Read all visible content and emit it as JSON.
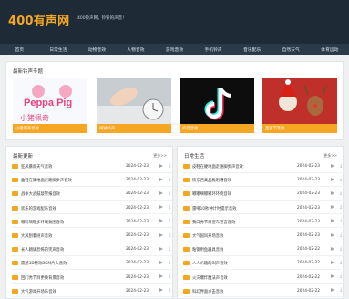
{
  "header": {
    "logo": "400有声网",
    "slogan": "400铃声网，铃铃的声音！"
  },
  "nav": [
    "首页",
    "日常生活",
    "动物音效",
    "人物音效",
    "游戏音效",
    "手机铃声",
    "音乐配乐",
    "自然天气",
    "体育运动"
  ],
  "featured": {
    "title": "最新铃声专题",
    "items": [
      {
        "caption": "小猪佩奇音效",
        "name": "peppa-pig"
      },
      {
        "caption": "闹钟铃声",
        "name": "alarm-clock"
      },
      {
        "caption": "抖音音效",
        "name": "tiktok"
      },
      {
        "caption": "圣诞节音效",
        "name": "christmas"
      }
    ]
  },
  "left": {
    "title": "最新更新",
    "more": "更多>>",
    "rows": [
      {
        "title": "狂风暴雨天气音效",
        "date": "2024-02-23"
      },
      {
        "title": "盒鞋在硬地面走路脚步声音效",
        "date": "2024-02-23"
      },
      {
        "title": "战争大战鼓敲警报音效",
        "date": "2024-02-23"
      },
      {
        "title": "欢乐的游戏配乐音效",
        "date": "2024-02-23"
      },
      {
        "title": "嘟吗嘀嘟多环境氛围音效",
        "date": "2024-02-23"
      },
      {
        "title": "大风刮着树声音效",
        "date": "2024-02-23"
      },
      {
        "title": "长人朗诵恐怖的笑声音效",
        "date": "2024-02-23"
      },
      {
        "title": "震撼3D特效BGM片头音效",
        "date": "2024-02-23"
      },
      {
        "title": "回门秀节目更换背景音效",
        "date": "2024-02-23"
      },
      {
        "title": "大气游戏开场乐音效",
        "date": "2024-02-23"
      }
    ]
  },
  "right": {
    "title": "日常生活",
    "more": "更多>>",
    "rows": [
      {
        "title": "皮鞋在硬地面走路脚步声音效",
        "date": "2024-02-23"
      },
      {
        "title": "饮东西高品脆咀嚼音效",
        "date": "2024-02-23"
      },
      {
        "title": "嘟嘟嘀嘟嘟环环绕音效",
        "date": "2024-02-23"
      },
      {
        "title": "雷嘀10秒钟计时提示音效",
        "date": "2024-02-23"
      },
      {
        "title": "我口秀节目宣布宣言音效",
        "date": "2024-02-23"
      },
      {
        "title": "大气国风开场音效",
        "date": "2024-02-23"
      },
      {
        "title": "粘钢用鱼器具音效",
        "date": "2024-02-22"
      },
      {
        "title": "人人爪踏的叫声音效",
        "date": "2024-02-22"
      },
      {
        "title": "火灾爆炸魔法声音效",
        "date": "2024-02-22"
      },
      {
        "title": "科幻界面点击音效",
        "date": "2024-02-22"
      }
    ]
  },
  "colors": {
    "accent": "#f5a623",
    "header": "#1e2b36",
    "nav": "#2a3a49"
  }
}
